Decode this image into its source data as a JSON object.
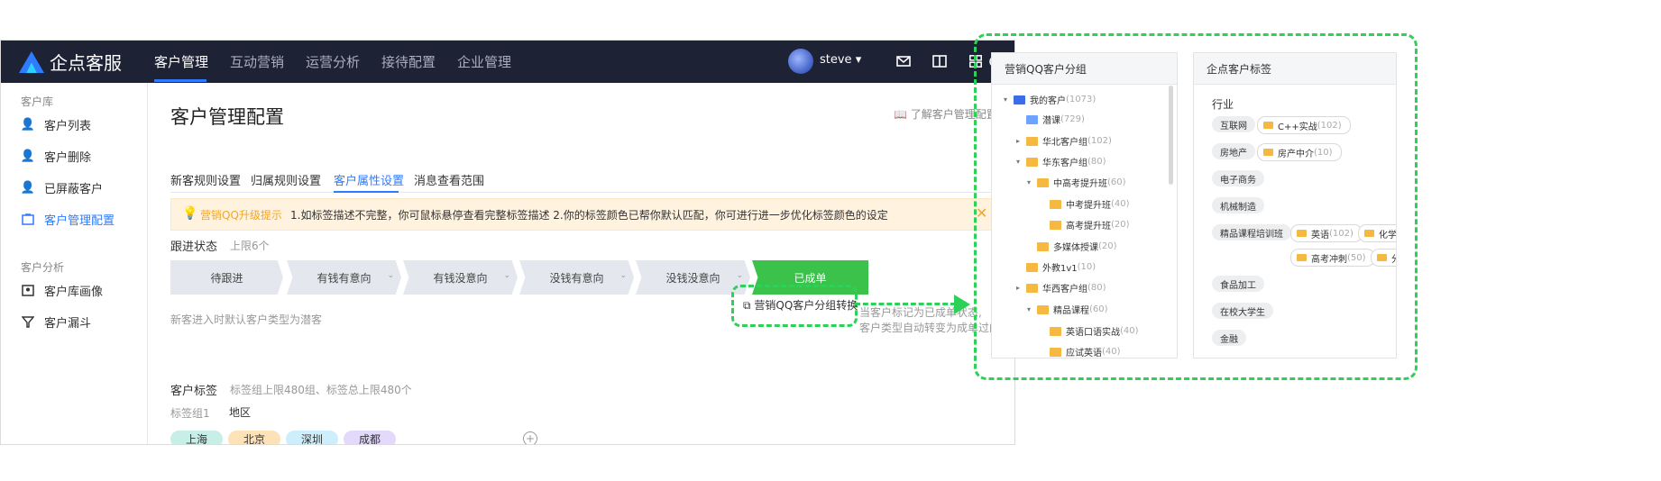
{
  "app": {
    "logo_text": "企点客服",
    "nav": [
      "客户管理",
      "互动营销",
      "运营分析",
      "接待配置",
      "企业管理"
    ],
    "user": "steve ▾"
  },
  "sidebar": {
    "group1": "客户库",
    "items1": [
      "客户列表",
      "客户删除",
      "已屏蔽客户",
      "客户管理配置"
    ],
    "group2": "客户分析",
    "items2": [
      "客户库画像",
      "客户漏斗"
    ]
  },
  "main": {
    "title": "客户管理配置",
    "learn": "了解客户管理配置",
    "tabs": [
      "新客规则设置",
      "归属规则设置",
      "客户属性设置",
      "消息查看范围"
    ],
    "notice": {
      "title": "营销QQ升级提示",
      "text": "1.如标签描述不完整，你可鼠标悬停查看完整标签描述 2.你的标签颜色已帮你默认匹配，你可进行进一步优化标签颜色的设定"
    },
    "follow": {
      "label": "跟进状态",
      "limit": "上限6个",
      "steps": [
        "待跟进",
        "有钱有意向",
        "有钱没意向",
        "没钱有意向",
        "没钱没意向",
        "已成单"
      ],
      "hint_left": "新客进入时默认客户类型为潜客",
      "hint_right_1": "当客户标记为已成单状态,",
      "hint_right_2": "客户类型自动转变为成单过的客户"
    },
    "tags": {
      "label": "客户标签",
      "limit": "标签组上限480组、标签总上限480个",
      "group_label": "标签组1",
      "group_name": "地区",
      "chips": [
        "上海",
        "北京",
        "深圳",
        "成都"
      ],
      "chip_colors": [
        "#c7eee7",
        "#fde2b8",
        "#cdeefb",
        "#e2d9fb"
      ],
      "convert": "营销QQ客户分组转换"
    }
  },
  "qq_panel": {
    "title": "营销QQ客户分组",
    "tree": [
      {
        "name": "我的客户",
        "count": "(1073)",
        "twisty": "▾"
      },
      {
        "name": "潜课",
        "count": "(729)",
        "twisty": ""
      },
      {
        "name": "华北客户组",
        "count": "(102)",
        "twisty": "▸"
      },
      {
        "name": "华东客户组",
        "count": "(80)",
        "twisty": "▾"
      },
      {
        "name": "中高考提升班",
        "count": "(60)",
        "twisty": "▾"
      },
      {
        "name": "中考提升班",
        "count": "(40)",
        "twisty": ""
      },
      {
        "name": "高考提升班",
        "count": "(20)",
        "twisty": ""
      },
      {
        "name": "多媒体授课",
        "count": "(20)",
        "twisty": ""
      },
      {
        "name": "外教1v1",
        "count": "(10)",
        "twisty": ""
      },
      {
        "name": "华西客户组",
        "count": "(80)",
        "twisty": "▸"
      },
      {
        "name": "精品课程",
        "count": "(60)",
        "twisty": "▾"
      },
      {
        "name": "英语口语实战",
        "count": "(40)",
        "twisty": ""
      },
      {
        "name": "应试英语",
        "count": "(40)",
        "twisty": ""
      }
    ]
  },
  "tag_panel": {
    "title": "企点客户标签",
    "industry": "行业",
    "rows": [
      {
        "name": "互联网",
        "items": [
          {
            "name": "C++实战",
            "count": "(102)"
          }
        ]
      },
      {
        "name": "房地产",
        "items": [
          {
            "name": "房产中介",
            "count": "(10)"
          }
        ]
      },
      {
        "name": "电子商务",
        "items": []
      },
      {
        "name": "机械制造",
        "items": []
      },
      {
        "name": "精品课程培训班",
        "items": [
          {
            "name": "英语",
            "count": "(102)"
          },
          {
            "name": "化学",
            "count": ""
          }
        ]
      },
      {
        "name": "",
        "items": [
          {
            "name": "高考冲刺",
            "count": "(50)"
          },
          {
            "name": "分",
            "count": ""
          }
        ]
      },
      {
        "name": "食品加工",
        "items": []
      },
      {
        "name": "在校大学生",
        "items": []
      },
      {
        "name": "金融",
        "items": []
      }
    ]
  }
}
